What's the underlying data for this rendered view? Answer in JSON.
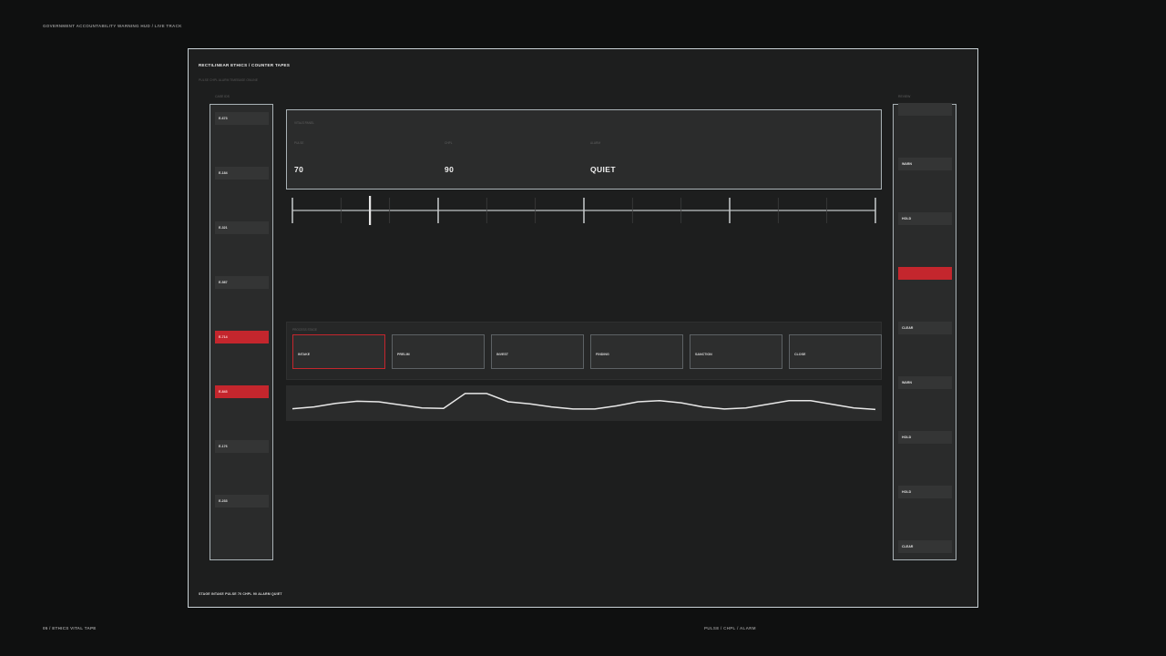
{
  "page": {
    "top_caption": "GOVERNMENT ACCOUNTABILITY WARNING HUD  /  LIVE TRACK",
    "bottom_left": "05 / ETHICS VITAL TAPE",
    "bottom_right": "PULSE / CHPL / ALARM"
  },
  "frame": {
    "title": "RECTILINEAR ETHICS  /  COUNTER TAPES",
    "subtitle": "PULSE  CHPL  ALARM  TIMEBASE  ONLINE",
    "footer": "STAGE INTAKE  PULSE 70  CHPL 90  ALARM QUIET"
  },
  "left_tape": {
    "label": "CASE IDS",
    "items": [
      {
        "label": "E-673",
        "alert": false
      },
      {
        "label": "E-184",
        "alert": false
      },
      {
        "label": "E-321",
        "alert": false
      },
      {
        "label": "E-587",
        "alert": false
      },
      {
        "label": "E-714",
        "alert": true
      },
      {
        "label": "E-843",
        "alert": true
      },
      {
        "label": "E-176",
        "alert": false
      },
      {
        "label": "E-233",
        "alert": false
      }
    ]
  },
  "right_tape": {
    "label": "REVIEW",
    "items": [
      {
        "label": "",
        "alert": false
      },
      {
        "label": "WARN",
        "alert": false
      },
      {
        "label": "HOLD",
        "alert": false
      },
      {
        "label": "",
        "alert": true
      },
      {
        "label": "CLEAR",
        "alert": false
      },
      {
        "label": "WARN",
        "alert": false
      },
      {
        "label": "HOLD",
        "alert": false
      },
      {
        "label": "HOLD",
        "alert": false
      },
      {
        "label": "CLEAR",
        "alert": false
      }
    ]
  },
  "readout": {
    "caption": "VITALS PANEL",
    "fields": [
      {
        "label": "PULSE",
        "value": "70"
      },
      {
        "label": "CHPL",
        "value": "90"
      },
      {
        "label": "ALARM",
        "value": "QUIET"
      }
    ]
  },
  "scale": {
    "min": 0,
    "max": 100,
    "major_ticks": [
      0,
      25,
      50,
      75,
      100
    ],
    "minor_step": 8.333,
    "pointer": 13.3
  },
  "stages": {
    "caption": "PROCESS STAGE",
    "items": [
      {
        "label": "INTAKE",
        "active": true
      },
      {
        "label": "PRELIM",
        "active": false
      },
      {
        "label": "INVEST",
        "active": false
      },
      {
        "label": "FINDING",
        "active": false
      },
      {
        "label": "SANCTION",
        "active": false
      },
      {
        "label": "CLOSE",
        "active": false
      }
    ]
  },
  "pulse_trace": {
    "values": [
      0.12,
      0.3,
      0.65,
      0.85,
      0.8,
      0.5,
      0.2,
      0.15,
      1.6,
      1.6,
      0.8,
      0.6,
      0.3,
      0.1,
      0.1,
      0.4,
      0.8,
      0.9,
      0.7,
      0.3,
      0.1,
      0.2,
      0.55,
      0.9,
      0.9,
      0.55,
      0.2,
      0.05
    ],
    "color": "#e8e8e8"
  },
  "colors": {
    "alert": "#c4262d",
    "panel_border": "#a9b2b6",
    "frame_border": "#c9d2d6"
  }
}
